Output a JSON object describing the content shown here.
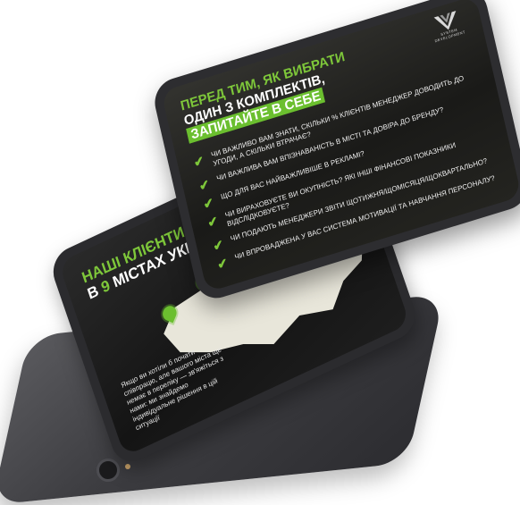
{
  "scene": {
    "background": "#ffffff",
    "accent": "#6bbf2f"
  },
  "map_tablet": {
    "title_line1": "НАШІ КЛІЄНТИ",
    "title_line2_prefix": "В ",
    "title_line2_number": "9",
    "title_line2_rest": " МІСТАХ УКР",
    "note": "Якщо ви хотіли б почати співпрацю, але вашого міста ще немає в переліку — зв'яжіться з нами: ми знайдемо індивідуальне рішення в цій ситуації"
  },
  "check_tablet": {
    "title_line1": "ПЕРЕД ТИМ, ЯК ВИБРАТИ",
    "title_line2": "ОДИН З КОМПЛЕКТІВ,",
    "title_line3": "ЗАПИТАЙТЕ В СЕБЕ",
    "logo_text_1": "SYSTEM",
    "logo_text_2": "DEVELOPMENT",
    "check_icon": "checkmark-icon",
    "items": [
      "ЧИ ВАЖЛИВО ВАМ ЗНАТИ, СКІЛЬКИ % КЛІЄНТІВ МЕНЕДЖЕР ДОВОДИТЬ ДО УГОДИ, А СКІЛЬКИ ВТРАЧАЄ?",
      "ЧИ ВАЖЛИВА ВАМ ВПІЗНАВАНІСТЬ В МІСТІ ТА ДОВІРА ДО БРЕНДУ?",
      "ЩО ДЛЯ ВАС НАЙВАЖЛИВІШЕ В РЕКЛАМІ?",
      "ЧИ ВИРАХОВУЄТЕ ВИ ОКУПНІСТЬ? ЯКІ ІНШІ ФІНАНСОВІ ПОКАЗНИКИ ВІДСЛІДКОВУЄТЕ?",
      "ЧИ ПОДАЮТЬ МЕНЕДЖЕРИ ЗВІТИ ЩОТИЖНЯ/ЩОМІСЯЦЯ/ЩОКВАРТАЛЬНО?",
      "ЧИ ВПРОВАДЖЕНА У ВАС СИСТЕМА МОТИВАЦІЇ ТА НАВЧАННЯ ПЕРСОНАЛУ?"
    ]
  }
}
